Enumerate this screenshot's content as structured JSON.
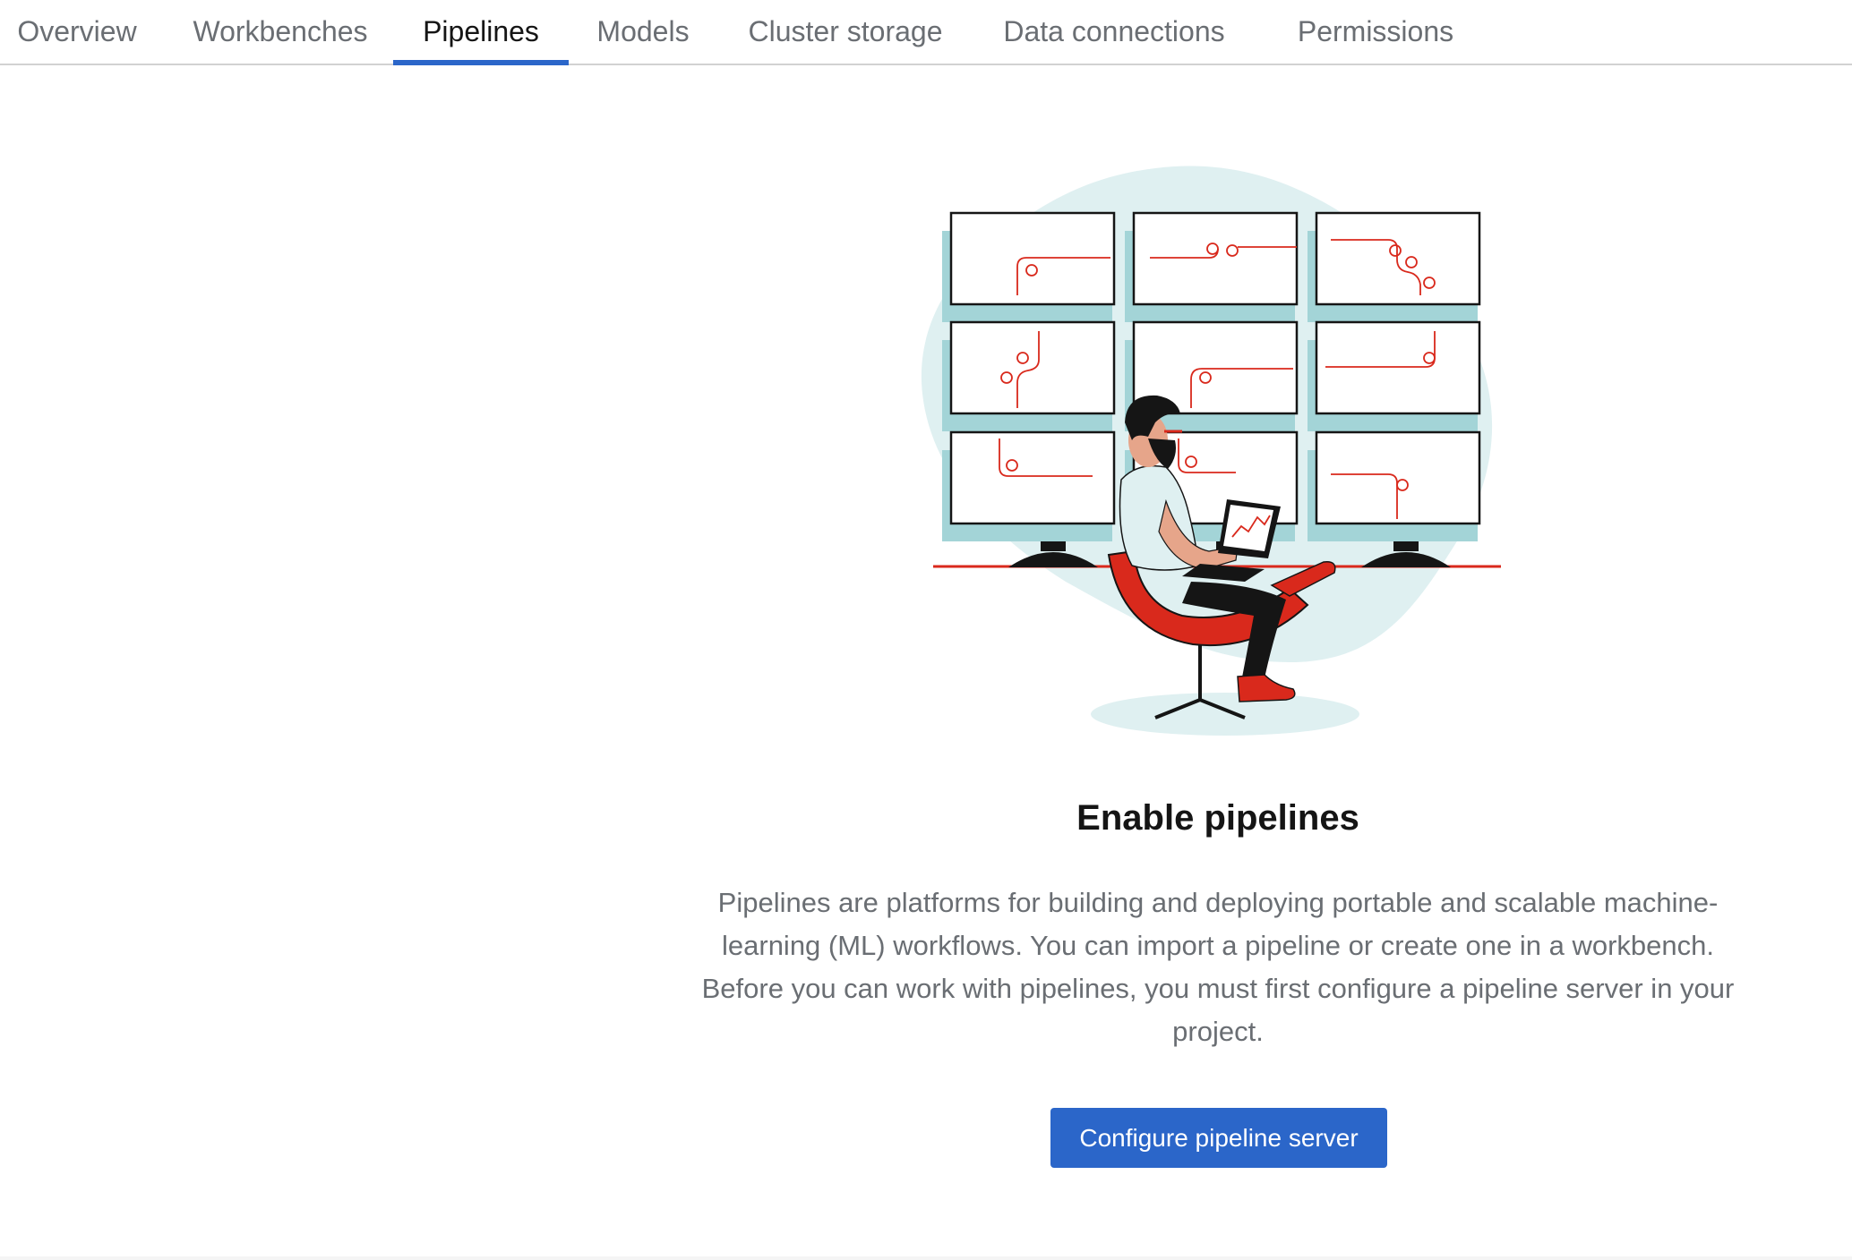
{
  "tabs": [
    {
      "label": "Overview",
      "active": false
    },
    {
      "label": "Workbenches",
      "active": false
    },
    {
      "label": "Pipelines",
      "active": true
    },
    {
      "label": "Models",
      "active": false
    },
    {
      "label": "Cluster storage",
      "active": false
    },
    {
      "label": "Data connections",
      "active": false
    },
    {
      "label": "Permissions",
      "active": false
    }
  ],
  "empty_state": {
    "illustration_icon": "person-with-monitors-illustration",
    "title": "Enable pipelines",
    "description_lines": [
      "Pipelines are platforms for building and deploying portable and scalable machine-",
      "learning (ML) workflows. You can import a pipeline or create one in a workbench.",
      "Before you can work with pipelines, you must first configure a pipeline server in your",
      "project."
    ],
    "button_label": "Configure pipeline server"
  },
  "colors": {
    "accent": "#2b66c9",
    "illustration_red": "#d9291c",
    "illustration_teal": "#a3d4d7"
  }
}
